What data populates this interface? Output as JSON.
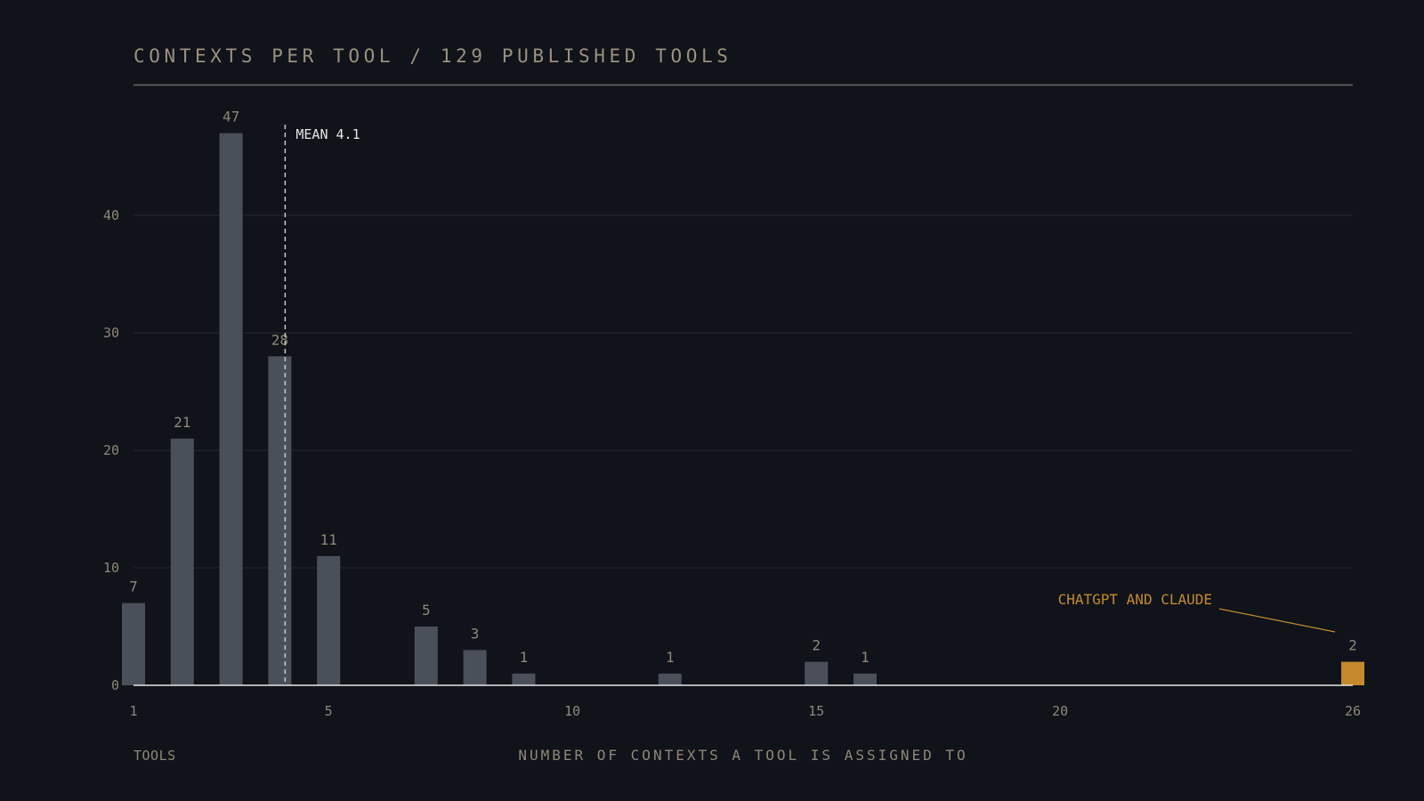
{
  "colors": {
    "background": "#10131a",
    "bar": "#4a5059",
    "highlight": "#c48a2c",
    "grid": "#262a31",
    "axis": "#e8e8e8",
    "rule": "#6a6a6a",
    "mean_line": "#c8c8c8"
  },
  "chart_data": {
    "type": "bar",
    "title": "CONTEXTS PER TOOL / 129 PUBLISHED TOOLS",
    "xlabel": "NUMBER OF CONTEXTS A TOOL IS ASSIGNED TO",
    "ylabel": "TOOLS",
    "xlim": [
      1,
      26
    ],
    "ylim": [
      0,
      48
    ],
    "x_ticks": [
      1,
      5,
      10,
      15,
      20,
      26
    ],
    "y_ticks": [
      0,
      10,
      20,
      30,
      40
    ],
    "grid": true,
    "x": [
      1,
      2,
      3,
      4,
      5,
      7,
      8,
      9,
      12,
      15,
      16,
      26
    ],
    "values": [
      7,
      21,
      47,
      28,
      11,
      5,
      3,
      1,
      1,
      2,
      1,
      2
    ],
    "highlight_x": 26,
    "mean": 4.1,
    "mean_label": "MEAN 4.1",
    "annotation": {
      "text": "CHATGPT AND CLAUDE",
      "x": 26
    }
  }
}
